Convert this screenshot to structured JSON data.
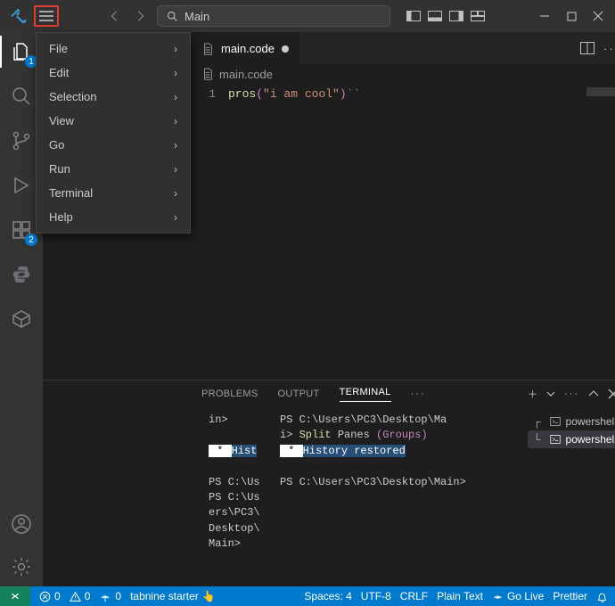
{
  "titlebar": {
    "search_label": "Main"
  },
  "menu": {
    "items": [
      {
        "label": "File",
        "sub": true
      },
      {
        "label": "Edit",
        "sub": true
      },
      {
        "label": "Selection",
        "sub": true
      },
      {
        "label": "View",
        "sub": true
      },
      {
        "label": "Go",
        "sub": true
      },
      {
        "label": "Run",
        "sub": true
      },
      {
        "label": "Terminal",
        "sub": true
      },
      {
        "label": "Help",
        "sub": true
      }
    ]
  },
  "activitybar": {
    "explorer_badge": "1",
    "extensions_badge": "2"
  },
  "tabs": {
    "main_label": "main.code"
  },
  "breadcrumb": {
    "file": "main.code"
  },
  "editor": {
    "line_no": "1",
    "fn": "pros",
    "open": "(",
    "str": "\"i am cool\"",
    "close": ")",
    "suffix": "``"
  },
  "panel": {
    "tabs": {
      "problems": "PROBLEMS",
      "output": "OUTPUT",
      "terminal": "TERMINAL"
    }
  },
  "terminal": {
    "col1": {
      "line1": "in>",
      "hl_star": " * ",
      "hl_hist": "Hist",
      "line3": "PS C:\\Us",
      "line4": "PS C:\\Us",
      "line5": "ers\\PC3\\",
      "line6": "Desktop\\",
      "line7": "Main>"
    },
    "col2": {
      "line1": "PS C:\\Users\\PC3\\Desktop\\Ma",
      "line2_pre": "i> ",
      "line2_y": "Split",
      "line2_w": " Panes ",
      "line2_p": "(Groups)",
      "hl_star": " * ",
      "hl_hist": "History restored",
      "line4": "PS C:\\Users\\PC3\\Desktop\\Main>"
    },
    "side": {
      "item1": "powershell",
      "item2": "powershell"
    }
  },
  "statusbar": {
    "errors": "0",
    "warnings": "0",
    "ports": "0",
    "tabnine": "tabnine starter",
    "spaces": "Spaces: 4",
    "encoding": "UTF-8",
    "eol": "CRLF",
    "lang": "Plain Text",
    "golive": "Go Live",
    "prettier": "Prettier"
  }
}
